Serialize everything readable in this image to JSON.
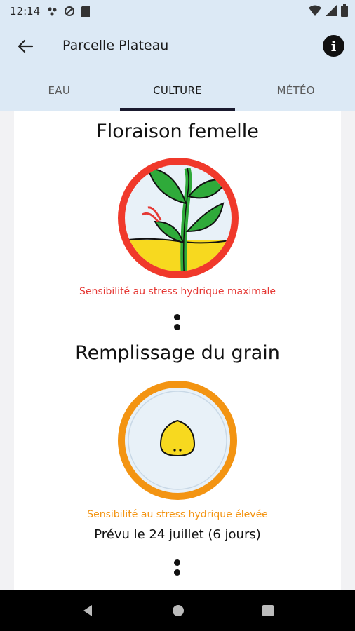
{
  "status_bar": {
    "time": "12:14"
  },
  "app_bar": {
    "title": "Parcelle Plateau"
  },
  "tabs": [
    {
      "label": "EAU",
      "active": false
    },
    {
      "label": "CULTURE",
      "active": true
    },
    {
      "label": "MÉTÉO",
      "active": false
    }
  ],
  "stages": [
    {
      "title": "Floraison femelle",
      "icon": "flowering-plant-icon",
      "ring_color": "#f0392b",
      "sensitivity": "Sensibilité au stress hydrique maximale",
      "sensitivity_color": "#e53935"
    },
    {
      "title": "Remplissage du grain",
      "icon": "grain-kernel-icon",
      "ring_color": "#f39412",
      "sensitivity": "Sensibilité au stress hydrique élevée",
      "sensitivity_color": "#f39412",
      "forecast": "Prévu le 24 juillet (6 jours)"
    }
  ]
}
